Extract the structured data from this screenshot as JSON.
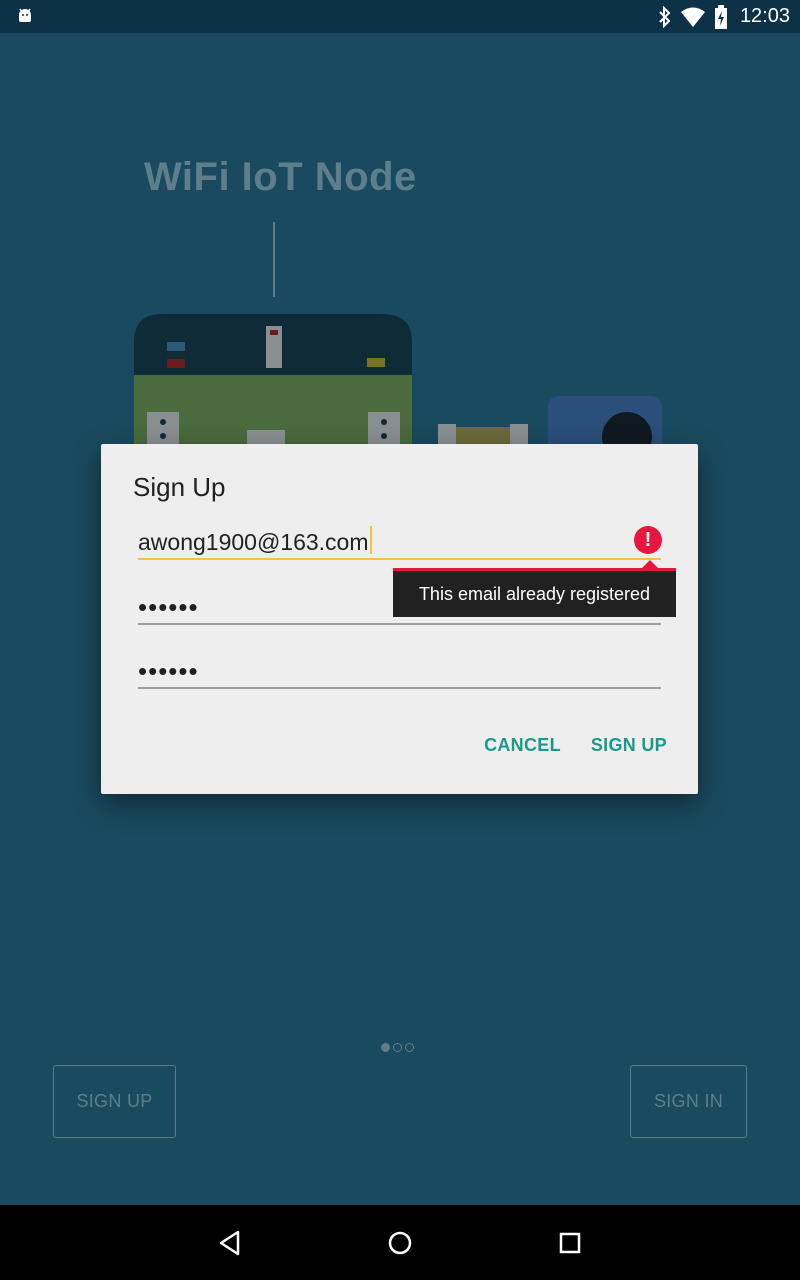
{
  "status_bar": {
    "time": "12:03"
  },
  "background": {
    "title": "WiFi IoT Node",
    "signup_label": "SIGN UP",
    "signin_label": "SIGN IN"
  },
  "dialog": {
    "title": "Sign Up",
    "email_value": "awong1900@163.com",
    "password_mask": "••••••",
    "confirm_mask": "••••••",
    "error_text": "This email already registered",
    "cancel_label": "CANCEL",
    "signup_label": "SIGN UP"
  },
  "colors": {
    "accent": "#1b9a8a",
    "error": "#e8163c",
    "focus_line": "#f5c23b",
    "background": "#1a4a5f"
  },
  "icons": [
    "android-icon",
    "bluetooth-icon",
    "wifi-icon",
    "battery-icon",
    "error-icon",
    "back-icon",
    "home-icon",
    "recents-icon"
  ]
}
